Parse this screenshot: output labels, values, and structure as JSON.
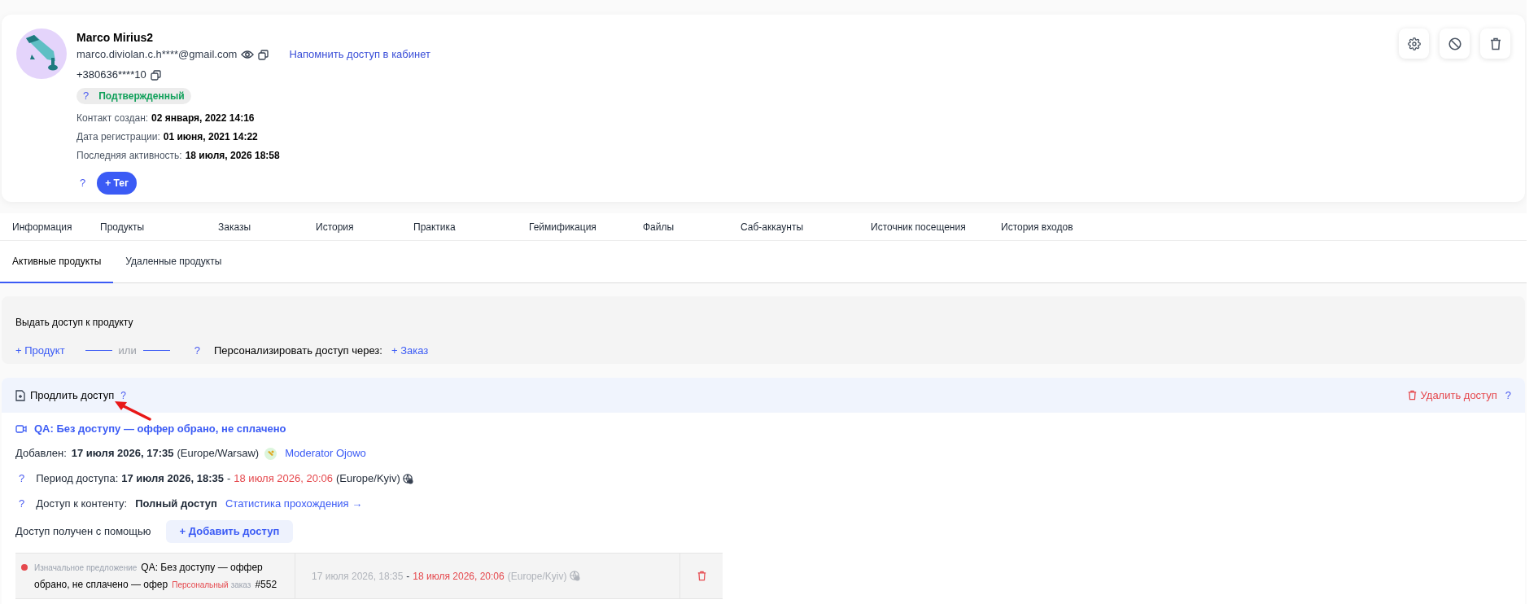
{
  "profile": {
    "name": "Marco Mirius2",
    "email": "marco.diviolan.c.h****@gmail.com",
    "remind_link": "Напомнить доступ в кабинет",
    "phone": "+380636****10",
    "status": {
      "help": "?",
      "label": "Подтвержденный"
    },
    "facts": [
      {
        "label": "Контакт создан:",
        "value": "02 января, 2022 14:16"
      },
      {
        "label": "Дата регистрации:",
        "value": "01 июня, 2021 14:22"
      },
      {
        "label": "Последняя активность:",
        "value": "18 июля, 2026 18:58"
      }
    ],
    "tag_help": "?",
    "tag_button": "+ Тег"
  },
  "tabs": [
    {
      "label": "Информация"
    },
    {
      "label": "Продукты"
    },
    {
      "label": "Заказы"
    },
    {
      "label": "История"
    },
    {
      "label": "Практика"
    },
    {
      "label": "Геймификация"
    },
    {
      "label": "Файлы"
    },
    {
      "label": "Саб-аккаунты"
    },
    {
      "label": "Источник посещения"
    },
    {
      "label": "История входов"
    }
  ],
  "subtabs": [
    {
      "label": "Активные продукты",
      "selected": true
    },
    {
      "label": "Удаленные продукты",
      "selected": false
    }
  ],
  "grant": {
    "title": "Выдать доступ к продукту",
    "product_link": "+ Продукт",
    "or": "или",
    "help": "?",
    "personalize_label": "Персонализировать доступ через:",
    "order_link": "+ Заказ"
  },
  "extend": {
    "title": "Продлить доступ",
    "help": "?",
    "delete_label": "Удалить доступ",
    "delete_help": "?"
  },
  "product": {
    "title": "QA: Без доступу — оффер обрано, не сплачено",
    "added_label": "Добавлен:",
    "added_value": "17 июля 2026, 17:35",
    "added_tz": "(Europe/Warsaw)",
    "moderator": "Moderator Ojowo",
    "period_help": "?",
    "period_label": "Период доступа:",
    "period_start": "17 июля 2026, 18:35",
    "period_sep": "-",
    "period_end": "18 июля 2026, 20:06",
    "period_tz": "(Europe/Kyiv)",
    "content_help": "?",
    "content_label": "Доступ к контенту:",
    "content_value": "Полный доступ",
    "stats_link": "Статистика прохождения →",
    "access_via_label": "Доступ получен с помощью",
    "add_access_button": "+ Добавить доступ"
  },
  "access_rows": [
    {
      "color": "#e5484d",
      "offer_label": "Изначальное предложение",
      "title": "QA: Без доступу — оффер обрано, не сплачено — офер",
      "order_type": "Персональный",
      "order_word": "заказ",
      "order_number": "#552",
      "start": "17 июля 2026, 18:35",
      "sep": "-",
      "end": "18 июля 2026, 20:06",
      "tz": "(Europe/Kyiv)"
    }
  ]
}
